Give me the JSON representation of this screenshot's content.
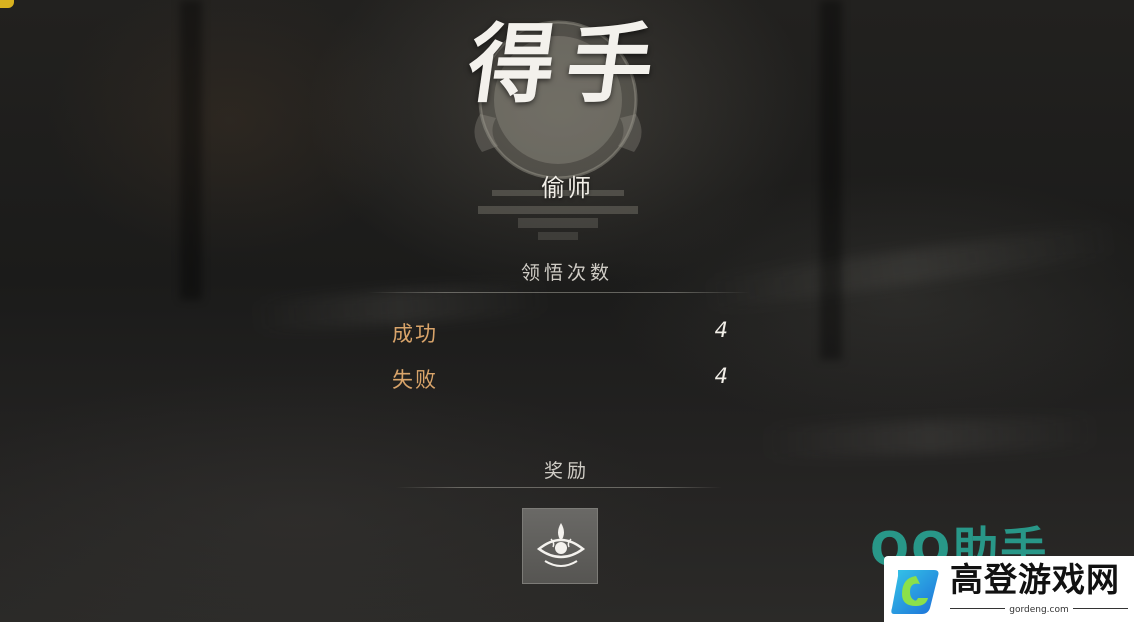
{
  "result": {
    "title": "得手",
    "subtitle": "偷师"
  },
  "stats": {
    "heading": "领悟次数",
    "rows": [
      {
        "label": "成功",
        "value": "4"
      },
      {
        "label": "失败",
        "value": "4"
      }
    ]
  },
  "reward": {
    "heading": "奖励",
    "items": [
      {
        "icon": "insight-eye-icon"
      }
    ]
  },
  "watermark": {
    "brand": "QQ助手",
    "name": "高登游戏网",
    "url": "gordeng.com"
  },
  "colors": {
    "stat_label": "#d9a46a",
    "accent_watermark": "#2abeaa"
  }
}
